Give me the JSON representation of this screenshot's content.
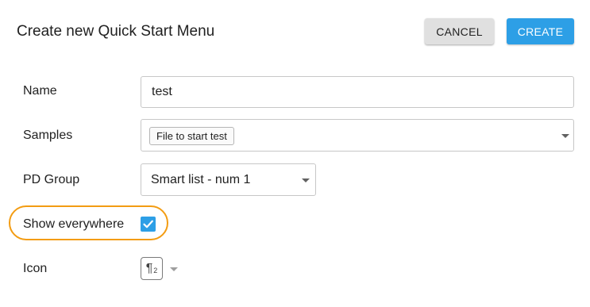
{
  "dialog": {
    "title": "Create new Quick Start Menu",
    "cancel_label": "CANCEL",
    "create_label": "CREATE"
  },
  "form": {
    "name": {
      "label": "Name",
      "value": "test"
    },
    "samples": {
      "label": "Samples",
      "chips": [
        "File to start test"
      ]
    },
    "pd_group": {
      "label": "PD Group",
      "value": "Smart list - num 1"
    },
    "show_everywhere": {
      "label": "Show everywhere",
      "checked": true
    },
    "icon": {
      "label": "Icon",
      "glyph": "¶",
      "sub": "2",
      "icon_name": "pilcrow-icon"
    }
  },
  "colors": {
    "accent": "#2d9fe6",
    "highlight": "#f39c12",
    "cancel_bg": "#e0e0e0"
  }
}
